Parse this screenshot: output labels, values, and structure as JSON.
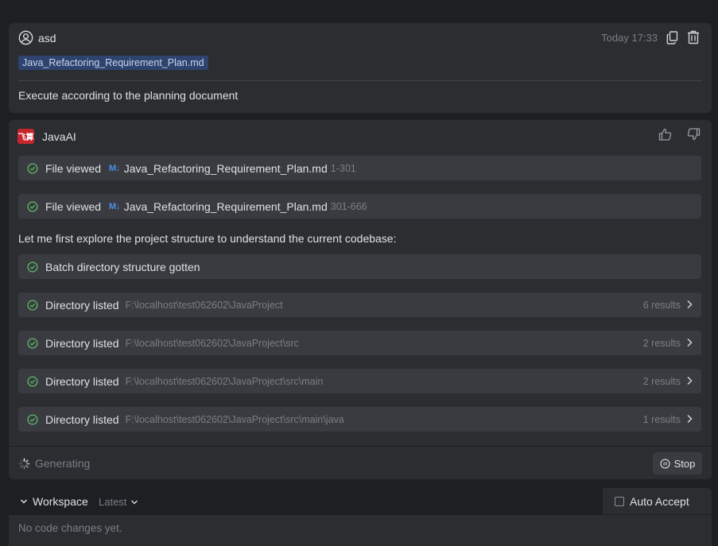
{
  "user_message": {
    "author": "asd",
    "timestamp": "Today 17:33",
    "attachment": "Java_Refactoring_Requirement_Plan.md",
    "text": "Execute according to the planning document"
  },
  "ai_message": {
    "author": "JavaAI",
    "logo_text": "飞算",
    "steps": [
      {
        "title": "File viewed",
        "badge": "M↓",
        "file": "Java_Refactoring_Requirement_Plan.md",
        "range": "1-301"
      },
      {
        "title": "File viewed",
        "badge": "M↓",
        "file": "Java_Refactoring_Requirement_Plan.md",
        "range": "301-666"
      }
    ],
    "paragraph": "Let me first explore the project structure to understand the current codebase:",
    "batch_step": {
      "title": "Batch directory structure gotten"
    },
    "dir_steps": [
      {
        "title": "Directory listed",
        "path": "F:\\localhost\\test062602\\JavaProject",
        "results": "6 results"
      },
      {
        "title": "Directory listed",
        "path": "F:\\localhost\\test062602\\JavaProject\\src",
        "results": "2 results"
      },
      {
        "title": "Directory listed",
        "path": "F:\\localhost\\test062602\\JavaProject\\src\\main",
        "results": "2 results"
      },
      {
        "title": "Directory listed",
        "path": "F:\\localhost\\test062602\\JavaProject\\src\\main\\java",
        "results": "1 results"
      }
    ],
    "status": "Generating",
    "stop_label": "Stop"
  },
  "workspace": {
    "title": "Workspace",
    "version": "Latest",
    "auto_accept": "Auto Accept",
    "empty_text": "No code changes yet."
  },
  "colors": {
    "background": "#1e1f22",
    "card": "#2b2d30",
    "step": "#393b40",
    "success": "#5fb865",
    "markdown_badge": "#4e8ee8",
    "brand": "#c7262d"
  }
}
